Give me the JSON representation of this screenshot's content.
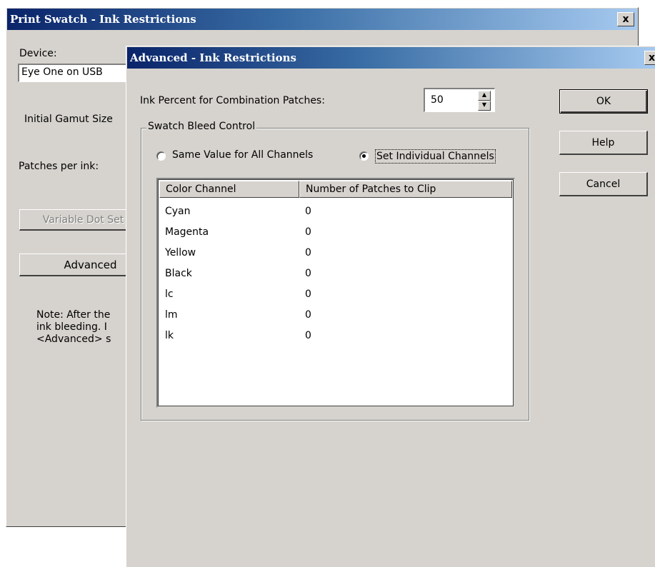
{
  "back_window": {
    "title": "Print Swatch - Ink Restrictions",
    "close_symbol": "x",
    "device_label": "Device:",
    "device_value": "Eye One on USB",
    "initial_gamut_label": "Initial Gamut Size",
    "patches_per_ink_label": "Patches per ink:",
    "variable_dot_button": "Variable Dot Set",
    "advanced_button": "Advanced",
    "note_lines": [
      "Note: After the",
      "ink bleeding.  I",
      "<Advanced> s"
    ]
  },
  "dialog": {
    "title": "Advanced - Ink Restrictions",
    "close_symbol": "x",
    "ink_percent_label": "Ink Percent for Combination Patches:",
    "ink_percent_value": "50",
    "ok_button": "OK",
    "help_button": "Help",
    "cancel_button": "Cancel",
    "group_label": "Swatch Bleed Control",
    "radio_same": "Same Value for All Channels",
    "radio_individual": "Set Individual Channels",
    "selected_radio": "individual",
    "table": {
      "columns": [
        "Color Channel",
        "Number of Patches to Clip"
      ],
      "rows": [
        [
          "Cyan",
          "0"
        ],
        [
          "Magenta",
          "0"
        ],
        [
          "Yellow",
          "0"
        ],
        [
          "Black",
          "0"
        ],
        [
          "lc",
          "0"
        ],
        [
          "lm",
          "0"
        ],
        [
          "lk",
          "0"
        ]
      ]
    }
  },
  "colors": {
    "face": "#d6d3ce",
    "title_start": "#0a246a",
    "title_end": "#a6caf0"
  }
}
